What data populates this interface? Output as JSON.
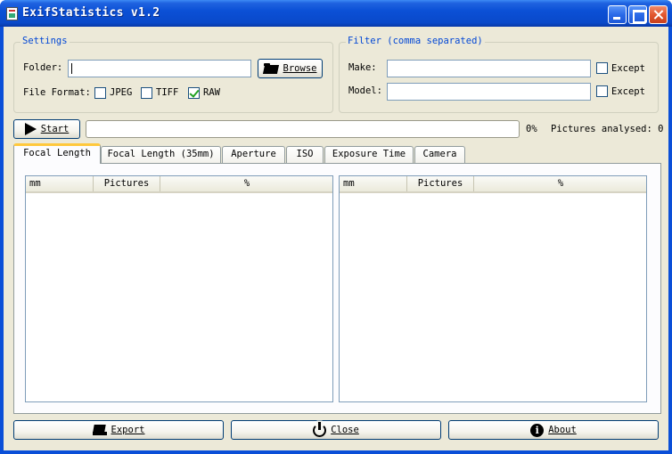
{
  "window": {
    "title": "ExifStatistics v1.2"
  },
  "settings": {
    "group_title": "Settings",
    "folder_label": "Folder:",
    "folder_value": "",
    "browse_label": "Browse",
    "file_format_label": "File Format:",
    "formats": [
      {
        "label": "JPEG",
        "checked": false
      },
      {
        "label": "TIFF",
        "checked": false
      },
      {
        "label": "RAW",
        "checked": true
      }
    ]
  },
  "filter": {
    "group_title": "Filter (comma separated)",
    "make_label": "Make:",
    "make_value": "",
    "model_label": "Model:",
    "model_value": "",
    "except_label": "Except",
    "make_except_checked": false,
    "model_except_checked": false
  },
  "run": {
    "start_label": "Start",
    "progress_percent": 0,
    "percent_text": "0%",
    "analysed_text": "Pictures analysed: 0"
  },
  "tabs": [
    {
      "label": "Focal Length",
      "active": true
    },
    {
      "label": "Focal Length (35mm)",
      "active": false
    },
    {
      "label": "Aperture",
      "active": false
    },
    {
      "label": "ISO",
      "active": false
    },
    {
      "label": "Exposure Time",
      "active": false
    },
    {
      "label": "Camera",
      "active": false
    }
  ],
  "lists": [
    {
      "columns": [
        "mm",
        "Pictures",
        "%"
      ]
    },
    {
      "columns": [
        "mm",
        "Pictures",
        "%"
      ]
    }
  ],
  "bottom_buttons": {
    "export_label": "Export",
    "close_label": "Close",
    "about_label": "About"
  },
  "icons": {
    "start": "play-icon",
    "browse": "folder-icon",
    "export": "drive-icon",
    "close": "power-icon",
    "about": "info-icon"
  }
}
